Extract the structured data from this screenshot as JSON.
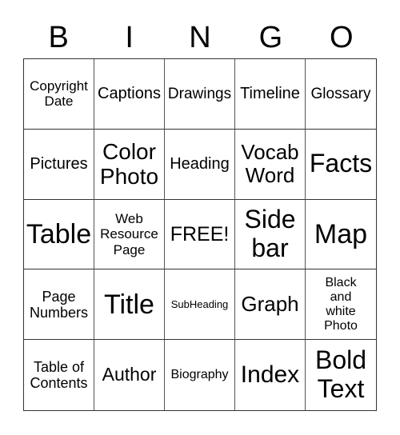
{
  "header": [
    "B",
    "I",
    "N",
    "G",
    "O"
  ],
  "cells": [
    "Copyright Date",
    "Captions",
    "Drawings",
    "Timeline",
    "Glossary",
    "Pictures",
    "Color Photo",
    "Heading",
    "Vocab Word",
    "Facts",
    "Table",
    "Web Resource Page",
    "FREE!",
    "Side bar",
    "Map",
    "Page Numbers",
    "Title",
    "SubHeading",
    "Graph",
    "Black and white Photo",
    "Table of Contents",
    "Author",
    "Biography",
    "Index",
    "Bold Text"
  ]
}
